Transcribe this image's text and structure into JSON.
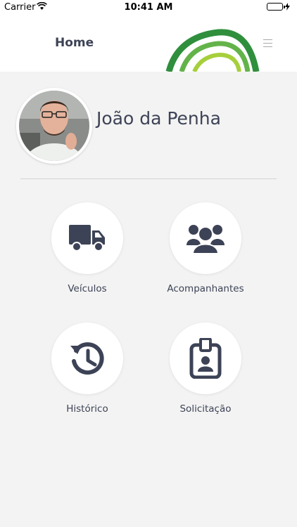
{
  "status_bar": {
    "carrier": "Carrier",
    "time": "10:41 AM"
  },
  "header": {
    "title": "Home"
  },
  "profile": {
    "name": "João da Penha"
  },
  "menu": [
    {
      "label": "Veículos",
      "icon": "truck-icon"
    },
    {
      "label": "Acompanhantes",
      "icon": "group-icon"
    },
    {
      "label": "Histórico",
      "icon": "history-icon"
    },
    {
      "label": "Solicitação",
      "icon": "id-badge-icon"
    }
  ],
  "colors": {
    "icon": "#3d4356",
    "logo_green": "#3a9a3a",
    "logo_light": "#a3cf3a"
  }
}
